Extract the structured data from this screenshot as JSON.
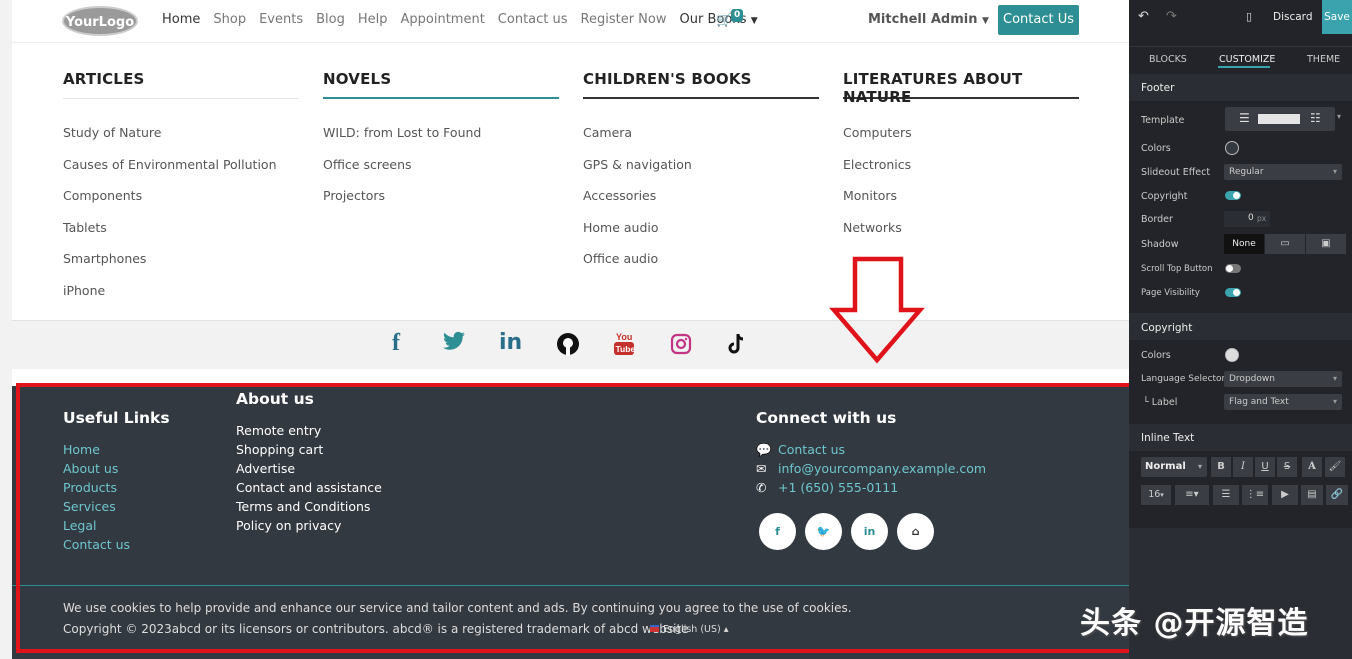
{
  "header": {
    "logo": "YourLogo",
    "nav": [
      "Home",
      "Shop",
      "Events",
      "Blog",
      "Help",
      "Appointment",
      "Contact us",
      "Register Now"
    ],
    "books_menu": "Our Books",
    "cart_count": "0",
    "user": "Mitchell Admin",
    "cta": "Contact Us"
  },
  "mega_menu": [
    {
      "title": "ARTICLES",
      "items": [
        "Study of Nature",
        "Causes of Environmental Pollution",
        "Components",
        "Tablets",
        "Smartphones",
        "iPhone"
      ]
    },
    {
      "title": "NOVELS",
      "items": [
        "WILD: from Lost to Found",
        "Office screens",
        "Projectors"
      ]
    },
    {
      "title": "CHILDREN'S BOOKS",
      "items": [
        "Camera",
        "GPS & navigation",
        "Accessories",
        "Home audio",
        "Office audio"
      ]
    },
    {
      "title": "LITERATURES ABOUT NATURE",
      "items": [
        "Computers",
        "Electronics",
        "Monitors",
        "Networks"
      ]
    }
  ],
  "social_icons": [
    "facebook-icon",
    "twitter-icon",
    "linkedin-icon",
    "github-icon",
    "youtube-icon",
    "instagram-icon",
    "tiktok-icon"
  ],
  "footer": {
    "useful_links": {
      "title": "Useful Links",
      "items": [
        "Home",
        "About us",
        "Products",
        "Services",
        "Legal",
        "Contact us"
      ]
    },
    "about": {
      "title": "About us",
      "items": [
        "Remote entry",
        "Shopping cart",
        "Advertise",
        "Contact and assistance",
        "Terms and Conditions",
        "Policy on privacy"
      ]
    },
    "connect": {
      "title": "Connect with us",
      "contact": "Contact us",
      "email": "info@yourcompany.example.com",
      "phone": "+1 (650) 555-0111"
    },
    "cookie_text": "We use cookies to help provide and enhance our service and tailor content and ads. By continuing you agree to the use of cookies.",
    "copyright": "Copyright © 2023abcd or its licensors or contributors. abcd® is a registered trademark of abcd website",
    "language": "English (US)"
  },
  "panel": {
    "discard": "Discard",
    "save": "Save",
    "tabs": [
      "BLOCKS",
      "CUSTOMIZE",
      "THEME"
    ],
    "footer_section": "Footer",
    "rows": {
      "template": "Template",
      "colors": "Colors",
      "slideout": "Slideout Effect",
      "slideout_value": "Regular",
      "copyright": "Copyright",
      "border": "Border",
      "border_value": "0",
      "border_unit": "px",
      "shadow": "Shadow",
      "shadow_value": "None",
      "scroll_top": "Scroll Top Button",
      "page_visibility": "Page Visibility"
    },
    "copyright_section": "Copyright",
    "copyright_rows": {
      "colors": "Colors",
      "language_selector": "Language Selector",
      "language_value": "Dropdown",
      "label": "Label",
      "label_prefix": "└",
      "label_value": "Flag and Text"
    },
    "inline_section": "Inline Text",
    "font_style": "Normal",
    "font_size": "16",
    "format_buttons": [
      "B",
      "I",
      "U",
      "S",
      "A"
    ]
  },
  "watermark": "头条 @开源智造",
  "colors": {
    "accent": "#2d8f94",
    "footer_bg": "#333941",
    "highlight": "#e0131a",
    "panel_bg": "#222429"
  }
}
